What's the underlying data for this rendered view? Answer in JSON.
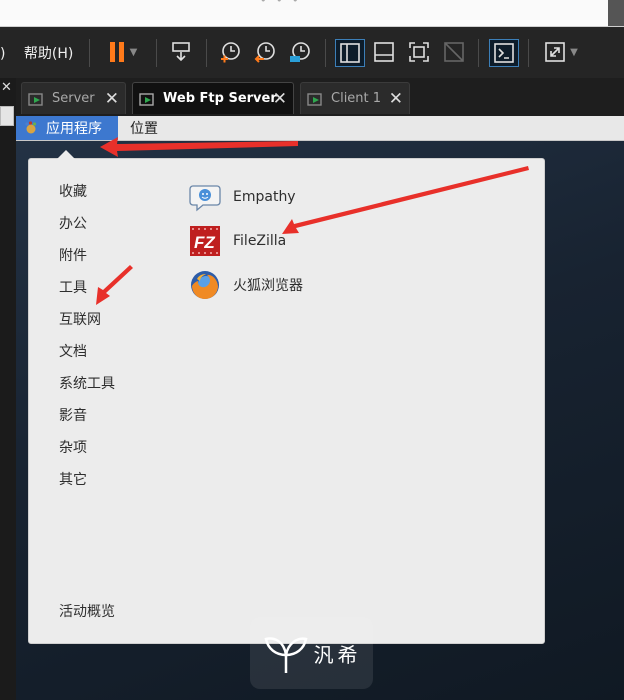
{
  "host_menu": {
    "paren": ")",
    "help": "帮助(H)"
  },
  "tabs": [
    {
      "label": "Server",
      "active": false
    },
    {
      "label": "Web Ftp Server",
      "active": true
    },
    {
      "label": "Client 1",
      "active": false
    }
  ],
  "tab_close_glyph": "✕",
  "guest": {
    "apps_menu_label": "应用程序",
    "places_label": "位置",
    "categories": [
      "收藏",
      "办公",
      "附件",
      "工具",
      "互联网",
      "文档",
      "系统工具",
      "影音",
      "杂项",
      "其它"
    ],
    "activities_label": "活动概览",
    "apps": [
      {
        "name": "Empathy",
        "icon": "empathy-chat-icon"
      },
      {
        "name": "FileZilla",
        "icon": "filezilla-icon"
      },
      {
        "name": "火狐浏览器",
        "icon": "firefox-icon"
      }
    ]
  },
  "watermark": "汎希",
  "colors": {
    "accent_blue": "#3d78cf",
    "pause_orange": "#ff7a1a",
    "annotation_red": "#e8302a",
    "toolbar_bg": "#252525",
    "menu_bg": "#ececec"
  }
}
